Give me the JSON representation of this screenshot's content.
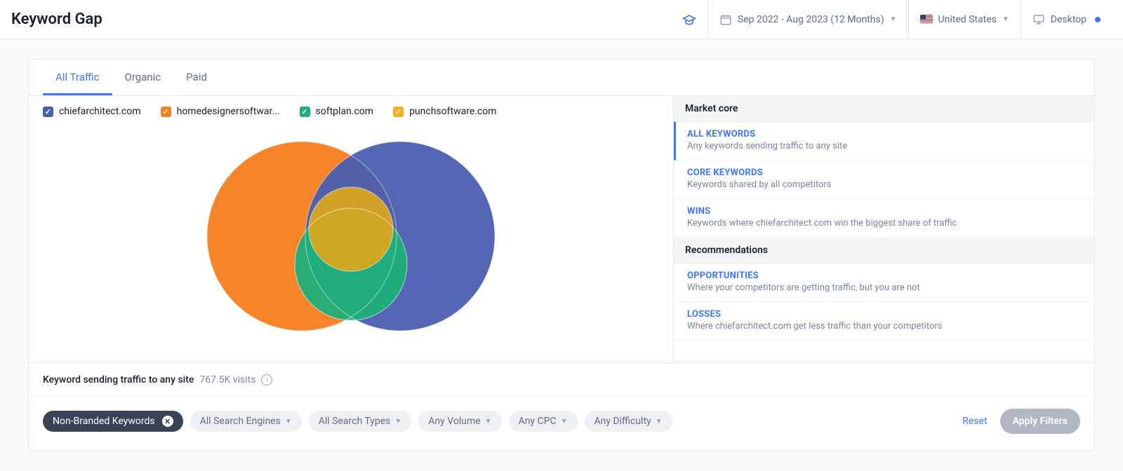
{
  "header": {
    "title": "Keyword Gap",
    "date_range": "Sep 2022 - Aug 2023 (12 Months)",
    "country": "United States",
    "device": "Desktop"
  },
  "tabs": [
    {
      "label": "All Traffic",
      "active": true
    },
    {
      "label": "Organic",
      "active": false
    },
    {
      "label": "Paid",
      "active": false
    }
  ],
  "legend": [
    {
      "label": "chiefarchitect.com",
      "color": "#4a5fb0"
    },
    {
      "label": "homedesignersoftwar...",
      "color": "#f5821f"
    },
    {
      "label": "softplan.com",
      "color": "#1fb07a"
    },
    {
      "label": "punchsoftware.com",
      "color": "#f5b01f"
    }
  ],
  "panel": {
    "section1": "Market core",
    "section2": "Recommendations",
    "options": [
      {
        "title": "ALL KEYWORDS",
        "desc": "Any keywords sending traffic to any site",
        "active": true
      },
      {
        "title": "CORE KEYWORDS",
        "desc": "Keywords shared by all competitors",
        "active": false
      },
      {
        "title": "WINS",
        "desc": "Keywords where chiefarchitect.com win the biggest share of traffic",
        "active": false
      },
      {
        "title": "OPPORTUNITIES",
        "desc": "Where your competitors are getting traffic, but you are not",
        "active": false
      },
      {
        "title": "LOSSES",
        "desc": "Where chiefarchitect.com get less traffic than your competitors",
        "active": false
      }
    ]
  },
  "summary": {
    "label": "Keyword sending traffic to any site",
    "visits": "767.5K visits"
  },
  "filters": {
    "chips": [
      {
        "label": "Non-Branded Keywords",
        "dark": true,
        "dropdown": false,
        "closable": true
      },
      {
        "label": "All Search Engines",
        "dark": false,
        "dropdown": true,
        "closable": false
      },
      {
        "label": "All Search Types",
        "dark": false,
        "dropdown": true,
        "closable": false
      },
      {
        "label": "Any Volume",
        "dark": false,
        "dropdown": true,
        "closable": false
      },
      {
        "label": "Any CPC",
        "dark": false,
        "dropdown": true,
        "closable": false
      },
      {
        "label": "Any Difficulty",
        "dark": false,
        "dropdown": true,
        "closable": false
      }
    ],
    "reset": "Reset",
    "apply": "Apply Filters"
  },
  "chart_data": {
    "type": "venn",
    "title": "Keyword Gap",
    "sets": [
      {
        "name": "chiefarchitect.com",
        "color": "#4a5fb0",
        "size_approx": 1.0
      },
      {
        "name": "homedesignersoftware.com",
        "color": "#f5821f",
        "size_approx": 1.0
      },
      {
        "name": "softplan.com",
        "color": "#1fb07a",
        "size_approx": 0.35
      },
      {
        "name": "punchsoftware.com",
        "color": "#f5b01f",
        "size_approx": 0.25
      }
    ],
    "note": "Sizes and overlaps estimated visually; large overlap among all four sets at center."
  }
}
